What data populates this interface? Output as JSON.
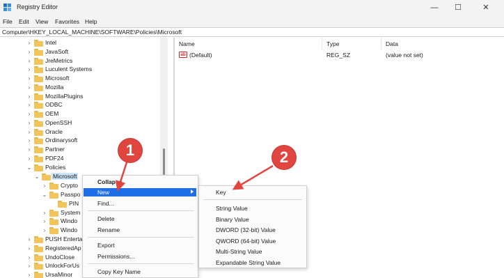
{
  "window": {
    "title": "Registry Editor",
    "controls": {
      "minimize": "—",
      "maximize": "☐",
      "close": "✕"
    }
  },
  "menu": [
    "File",
    "Edit",
    "View",
    "Favorites",
    "Help"
  ],
  "address": "Computer\\HKEY_LOCAL_MACHINE\\SOFTWARE\\Policies\\Microsoft",
  "tree": {
    "items": [
      {
        "label": "Intel",
        "chevron": "›"
      },
      {
        "label": "JavaSoft",
        "chevron": "›"
      },
      {
        "label": "JreMetrics",
        "chevron": "›"
      },
      {
        "label": "Luculent Systems",
        "chevron": "›"
      },
      {
        "label": "Microsoft",
        "chevron": "›"
      },
      {
        "label": "Mozilla",
        "chevron": "›"
      },
      {
        "label": "MozillaPlugins",
        "chevron": "›"
      },
      {
        "label": "ODBC",
        "chevron": "›"
      },
      {
        "label": "OEM",
        "chevron": "›"
      },
      {
        "label": "OpenSSH",
        "chevron": "›"
      },
      {
        "label": "Oracle",
        "chevron": "›"
      },
      {
        "label": "Ordinarysoft",
        "chevron": "›"
      },
      {
        "label": "Partner",
        "chevron": "›"
      },
      {
        "label": "PDF24",
        "chevron": "›"
      },
      {
        "label": "Policies",
        "chevron": "⌄"
      },
      {
        "label": "Microsoft",
        "chevron": "⌄"
      },
      {
        "label": "Crypto",
        "chevron": "›"
      },
      {
        "label": "Passpo",
        "chevron": "⌄"
      },
      {
        "label": "PIN",
        "chevron": ""
      },
      {
        "label": "System",
        "chevron": "›"
      },
      {
        "label": "Windo",
        "chevron": "›"
      },
      {
        "label": "Windo",
        "chevron": "›"
      },
      {
        "label": "PUSH Enterta",
        "chevron": "›"
      },
      {
        "label": "RegisteredAp",
        "chevron": "›"
      },
      {
        "label": "UndoClose",
        "chevron": "›"
      },
      {
        "label": "UnlockForUs",
        "chevron": "›"
      },
      {
        "label": "UrsaMinor",
        "chevron": "›"
      }
    ]
  },
  "list": {
    "columns": [
      "Name",
      "Type",
      "Data"
    ],
    "rows": [
      {
        "icon": "ab",
        "name": "(Default)",
        "type": "REG_SZ",
        "data": "(value not set)"
      }
    ]
  },
  "context_menu": {
    "items": [
      "Collapse",
      "New",
      "Find...",
      "Delete",
      "Rename",
      "Export",
      "Permissions...",
      "Copy Key Name"
    ],
    "highlighted": "New"
  },
  "submenu": {
    "items": [
      "Key",
      "String Value",
      "Binary Value",
      "DWORD (32-bit) Value",
      "QWORD (64-bit) Value",
      "Multi-String Value",
      "Expandable String Value"
    ]
  },
  "callouts": [
    "1",
    "2"
  ],
  "colors": {
    "highlight": "#1e6fe6",
    "callout": "#e0453f",
    "folder": "#f2c55c",
    "selection": "#cce4f7"
  },
  "icons": [
    "registry-editor-icon",
    "folder-icon",
    "chevron-right-icon",
    "chevron-down-icon",
    "string-value-icon",
    "submenu-arrow-icon",
    "arrow-icon"
  ]
}
